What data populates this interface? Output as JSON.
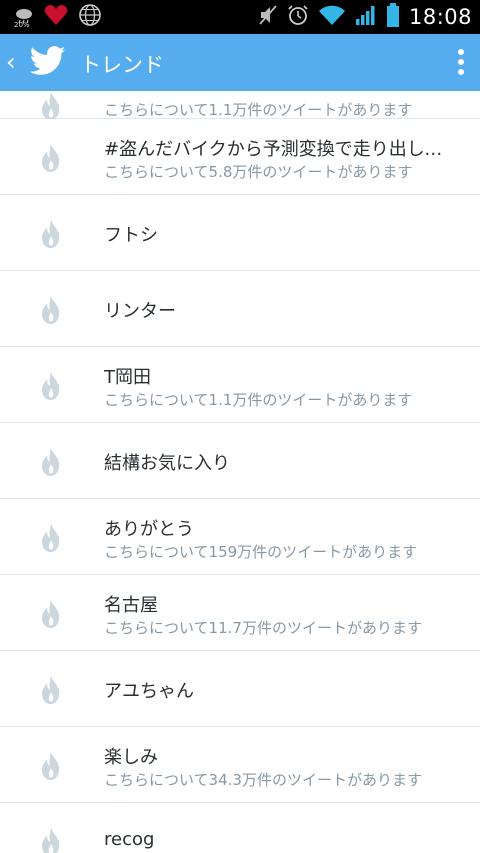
{
  "status_bar": {
    "time": "18:08",
    "weather_temp": "20%",
    "icons_left": [
      "weather-icon",
      "heart-icon",
      "globe-icon"
    ],
    "icons_right": [
      "mute-icon",
      "alarm-icon",
      "wifi-icon",
      "signal-icon",
      "battery-icon"
    ]
  },
  "action_bar": {
    "back_glyph": "‹",
    "title": "トレンド"
  },
  "trends": [
    {
      "title": "",
      "subtitle": "こちらについて1.1万件のツイートがあります"
    },
    {
      "title": "#盗んだバイクから予測変換で走り出して...",
      "subtitle": "こちらについて5.8万件のツイートがあります"
    },
    {
      "title": "フトシ",
      "subtitle": ""
    },
    {
      "title": "リンター",
      "subtitle": ""
    },
    {
      "title": "T岡田",
      "subtitle": "こちらについて1.1万件のツイートがあります"
    },
    {
      "title": "結構お気に入り",
      "subtitle": ""
    },
    {
      "title": "ありがとう",
      "subtitle": "こちらについて159万件のツイートがあります"
    },
    {
      "title": "名古屋",
      "subtitle": "こちらについて11.7万件のツイートがあります"
    },
    {
      "title": "アユちゃん",
      "subtitle": ""
    },
    {
      "title": "楽しみ",
      "subtitle": "こちらについて34.3万件のツイートがあります"
    },
    {
      "title": "recog",
      "subtitle": ""
    }
  ],
  "colors": {
    "action_bar": "#55acee",
    "flame": "#ccd6dd",
    "title": "#292f33",
    "subtitle": "#8899a6"
  }
}
